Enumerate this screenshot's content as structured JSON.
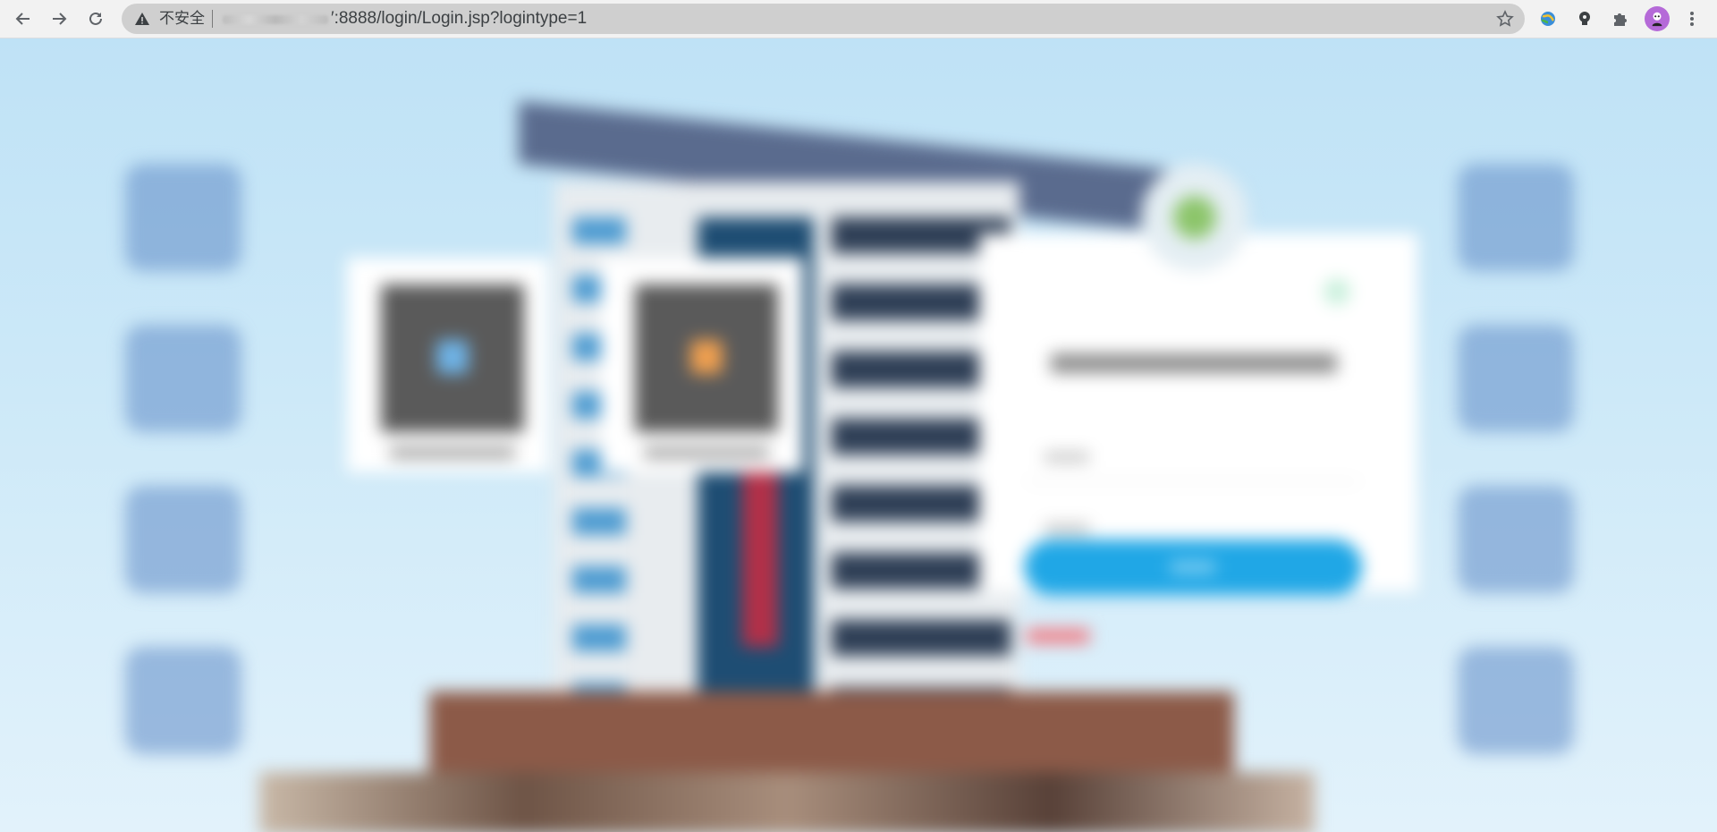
{
  "browser": {
    "security_label": "不安全",
    "url_visible": "′:8888/login/Login.jsp?logintype=1",
    "icons": [
      "back-arrow-icon",
      "forward-arrow-icon",
      "reload-icon",
      "warning-icon",
      "star-icon",
      "globe-extension-icon",
      "lightbulb-extension-icon",
      "puzzle-extensions-icon",
      "profile-avatar",
      "menu-dots-icon"
    ],
    "colors": {
      "toolbar": "#f2f2f2",
      "omnibox": "#cfcfcf",
      "avatar": "#b56ad8"
    }
  },
  "page": {
    "colors": {
      "sky": "#bfe2f6",
      "login_button": "#20a7e6",
      "error_text": "#f07a82"
    }
  }
}
